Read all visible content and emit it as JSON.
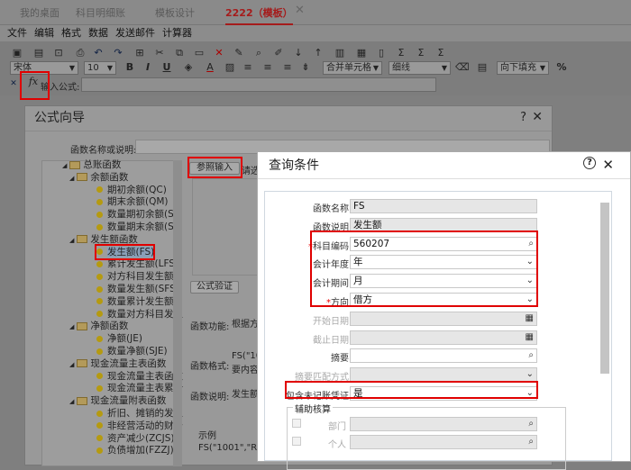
{
  "tabs": [
    "我的桌面",
    "科目明细账",
    "模板设计",
    "2222（模板）"
  ],
  "menu": [
    "文件",
    "编辑",
    "格式",
    "数据",
    "发送邮件",
    "计算器"
  ],
  "format": {
    "font": "宋体",
    "size": "10",
    "merge": "合并单元格",
    "border": "细线",
    "fill": "向下填充",
    "percent": "%"
  },
  "formula_bar": {
    "label": "输入公式:",
    "value": ""
  },
  "wizard": {
    "title": "公式向导",
    "search_label": "函数名称或说明:",
    "ref_button": "参照输入",
    "hint": "请选",
    "verify_button": "公式验证",
    "func_label": "函数功能:",
    "func_value": "根据方",
    "format_label": "函数格式:",
    "format_value": "FS(\"10",
    "format_value2": "要内容",
    "desc_label": "函数说明:",
    "desc_value": "发生额",
    "example_label": "示例",
    "example_value": "FS(\"1001\",\"RM",
    "tree": [
      {
        "level": 0,
        "type": "folder",
        "label": "总账函数"
      },
      {
        "level": 1,
        "type": "folder",
        "label": "余额函数"
      },
      {
        "level": 2,
        "type": "leaf",
        "label": "期初余额(QC)"
      },
      {
        "level": 2,
        "type": "leaf",
        "label": "期末余额(QM)"
      },
      {
        "level": 2,
        "type": "leaf",
        "label": "数量期初余额(SQ"
      },
      {
        "level": 2,
        "type": "leaf",
        "label": "数量期末余额(SQ"
      },
      {
        "level": 1,
        "type": "folder",
        "label": "发生额函数"
      },
      {
        "level": 2,
        "type": "leaf",
        "label": "发生额(FS)",
        "selected": true
      },
      {
        "level": 2,
        "type": "leaf",
        "label": "累计发生额(LFS)"
      },
      {
        "level": 2,
        "type": "leaf",
        "label": "对方科目发生额("
      },
      {
        "level": 2,
        "type": "leaf",
        "label": "数量发生额(SFS)"
      },
      {
        "level": 2,
        "type": "leaf",
        "label": "数量累计发生额("
      },
      {
        "level": 2,
        "type": "leaf",
        "label": "数量对方科目发生"
      },
      {
        "level": 1,
        "type": "folder",
        "label": "净额函数"
      },
      {
        "level": 2,
        "type": "leaf",
        "label": "净额(JE)"
      },
      {
        "level": 2,
        "type": "leaf",
        "label": "数量净额(SJE)"
      },
      {
        "level": 1,
        "type": "folder",
        "label": "现金流量主表函数"
      },
      {
        "level": 2,
        "type": "leaf",
        "label": "现金流量主表函数"
      },
      {
        "level": 2,
        "type": "leaf",
        "label": "现金流量主表累计"
      },
      {
        "level": 1,
        "type": "folder",
        "label": "现金流量附表函数"
      },
      {
        "level": 2,
        "type": "leaf",
        "label": "折旧、摊销的发生"
      },
      {
        "level": 2,
        "type": "leaf",
        "label": "非经营活动的财务"
      },
      {
        "level": 2,
        "type": "leaf",
        "label": "资产减少(ZCJS)"
      },
      {
        "level": 2,
        "type": "leaf",
        "label": "负债增加(FZZJ)"
      }
    ]
  },
  "query": {
    "title": "查询条件",
    "fields": [
      {
        "label": "函数名称",
        "value": "FS",
        "disabled": true,
        "icon": ""
      },
      {
        "label": "函数说明",
        "value": "发生额",
        "disabled": true,
        "icon": ""
      },
      {
        "label": "科目编码",
        "value": "560207",
        "required": true,
        "icon": "search"
      },
      {
        "label": "会计年度",
        "value": "年",
        "icon": "chevron"
      },
      {
        "label": "会计期间",
        "value": "月",
        "icon": "chevron"
      },
      {
        "label": "方向",
        "value": "借方",
        "required": true,
        "icon": "chevron"
      },
      {
        "label": "开始日期",
        "value": "",
        "disabled": true,
        "icon": "calendar"
      },
      {
        "label": "截止日期",
        "value": "",
        "disabled": true,
        "icon": "calendar"
      },
      {
        "label": "摘要",
        "value": "",
        "icon": "search-doc"
      },
      {
        "label": "摘要匹配方式",
        "value": "",
        "disabled": true,
        "icon": "chevron"
      },
      {
        "label": "包含未记账凭证",
        "value": "是",
        "icon": "chevron"
      }
    ],
    "aux_title": "辅助核算",
    "aux": [
      {
        "label": "部门",
        "value": ""
      },
      {
        "label": "个人",
        "value": ""
      }
    ]
  }
}
